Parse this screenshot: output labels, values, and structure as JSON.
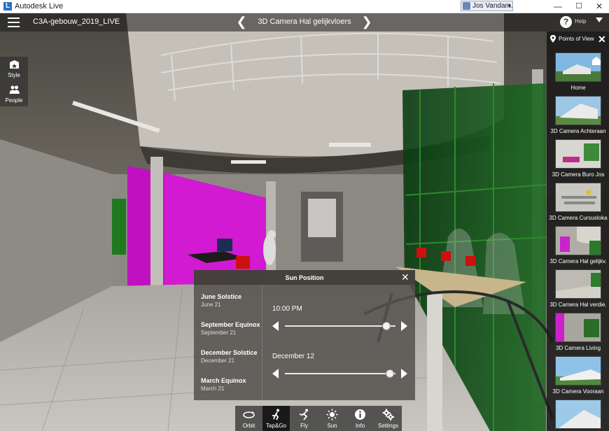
{
  "window": {
    "title": "Autodesk Live",
    "logo_letter": "L",
    "user": "Jos Vandam...",
    "minimize": "—",
    "maximize": "☐",
    "close": "✕"
  },
  "app_bar": {
    "project_title": "C3A-gebouw_2019_LIVE",
    "current_view": "3D Camera Hal gelijkvloers",
    "prev_glyph": "❮",
    "next_glyph": "❯",
    "help_label": "Help"
  },
  "left_tools": [
    {
      "label": "Style",
      "icon": "style-icon"
    },
    {
      "label": "People",
      "icon": "people-icon"
    }
  ],
  "points_of_view": {
    "title": "Points of View",
    "close_glyph": "✕",
    "items": [
      {
        "label": "Home"
      },
      {
        "label": "3D Camera Achteraan"
      },
      {
        "label": "3D Camera Buro Jos"
      },
      {
        "label": "3D Camera Cursusloka"
      },
      {
        "label": "3D Camera Hal gelijkv."
      },
      {
        "label": "3D Camera Hal verdie."
      },
      {
        "label": "3D Camera Living"
      },
      {
        "label": "3D Camera Vooraan"
      },
      {
        "label": ""
      }
    ]
  },
  "sun_panel": {
    "title": "Sun Position",
    "close_glyph": "✕",
    "presets": [
      {
        "name": "June Solstice",
        "date": "June 21"
      },
      {
        "name": "September Equinox",
        "date": "September 21"
      },
      {
        "name": "December Solstice",
        "date": "December 21"
      },
      {
        "name": "March Equinox",
        "date": "March 21"
      }
    ],
    "time_value": "10:00 PM",
    "time_fraction": 0.917,
    "date_value": "December 12",
    "date_fraction": 0.95
  },
  "toolbar": [
    {
      "label": "Orbit",
      "icon": "orbit-icon",
      "active": false
    },
    {
      "label": "Tap&Go",
      "icon": "tap-go-icon",
      "active": true
    },
    {
      "label": "Fly",
      "icon": "fly-icon",
      "active": false
    },
    {
      "label": "Sun",
      "icon": "sun-icon",
      "active": false
    },
    {
      "label": "Info",
      "icon": "info-icon",
      "active": false
    },
    {
      "label": "Settings",
      "icon": "settings-icon",
      "active": false
    }
  ]
}
